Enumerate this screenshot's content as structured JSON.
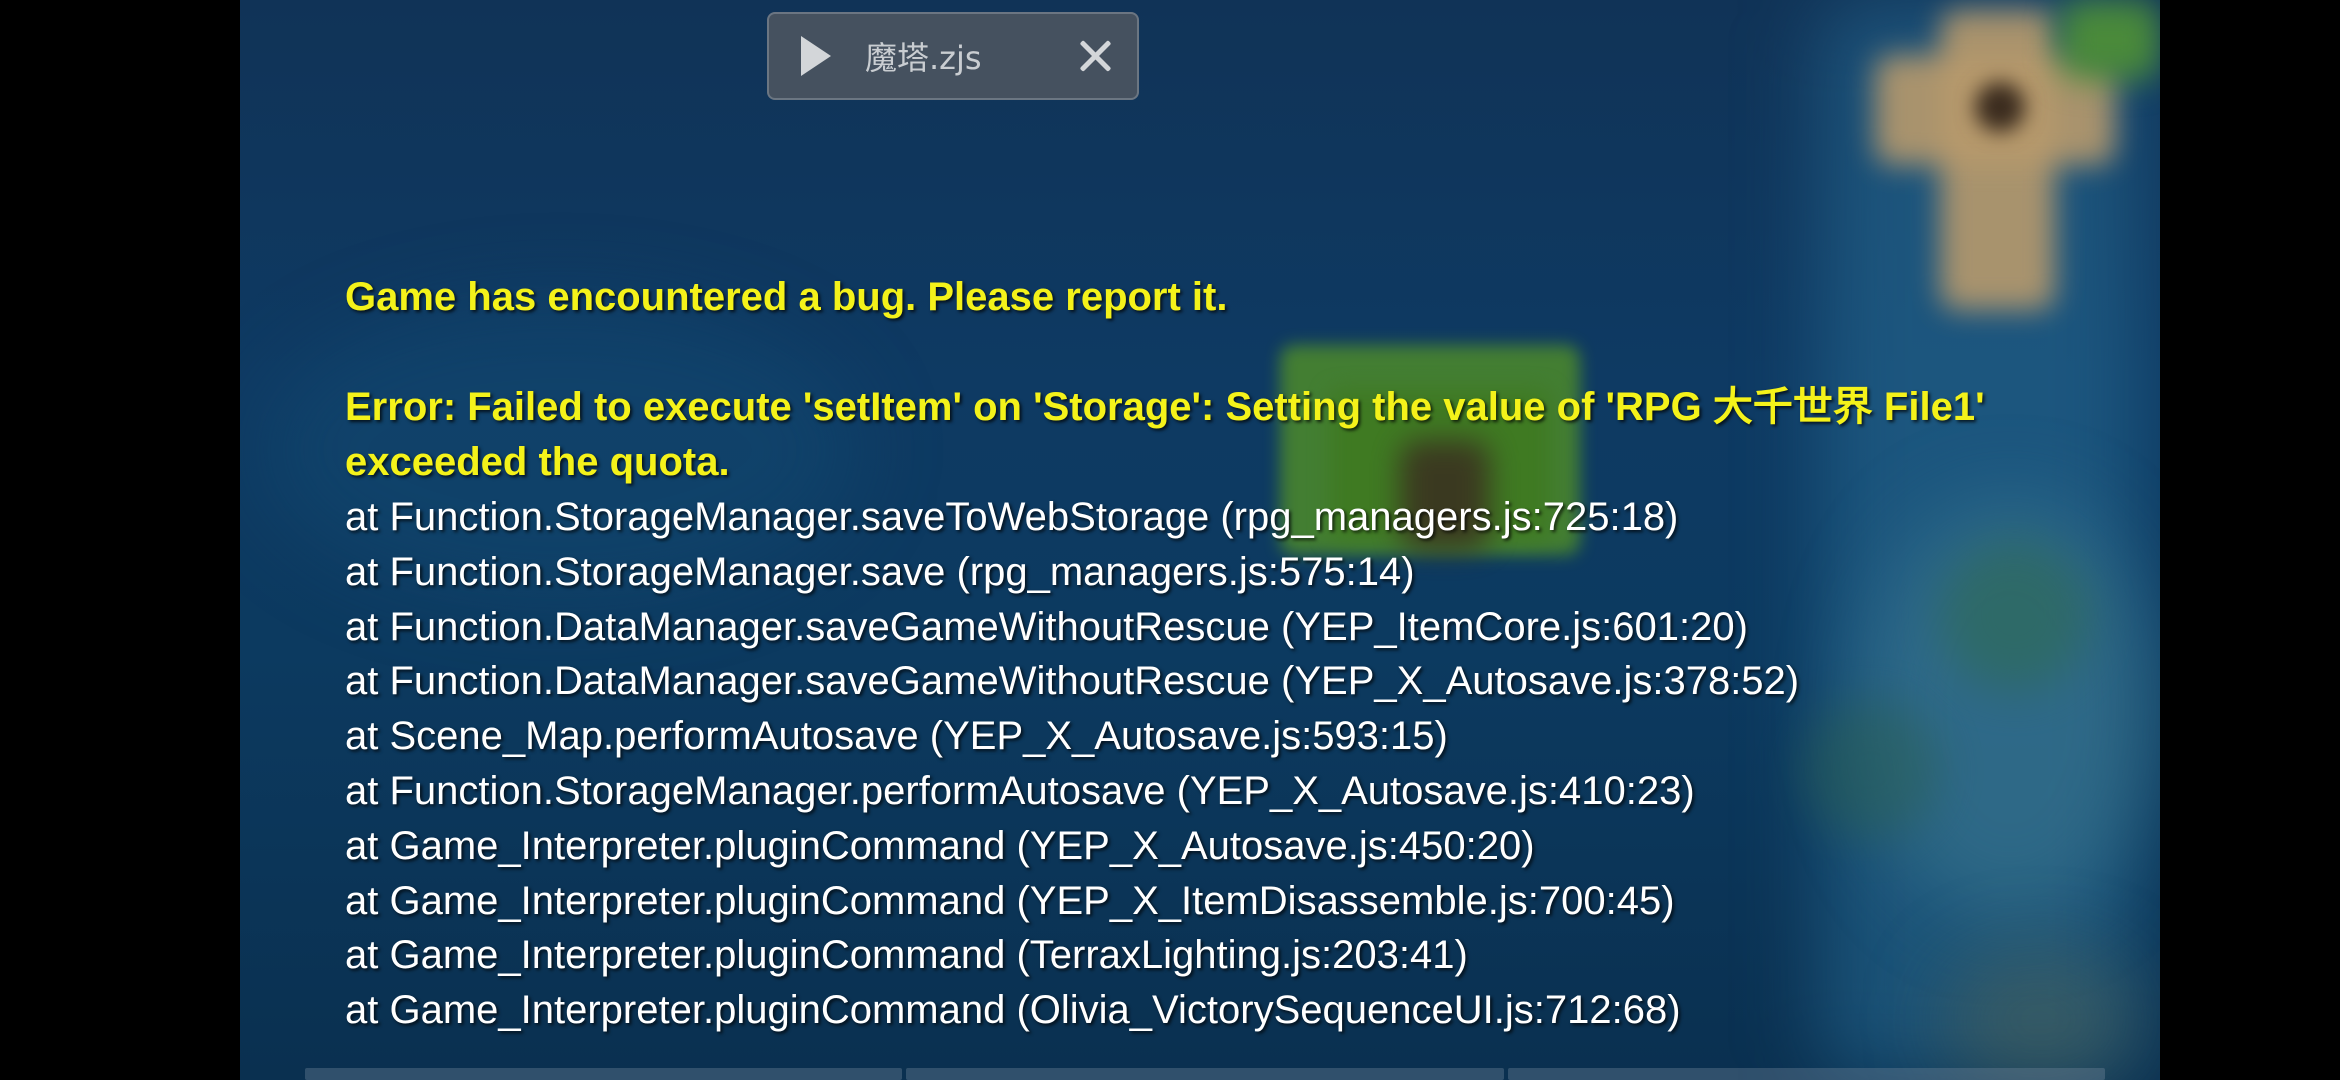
{
  "window": {
    "tab_title": "魔塔.zjs",
    "icons": {
      "play": "play-icon",
      "close": "close-icon"
    }
  },
  "error": {
    "title": "Game has encountered a bug. Please report it.",
    "message": "Error: Failed to execute 'setItem' on 'Storage': Setting the value of 'RPG 大千世界 File1' exceeded the quota.",
    "stack": [
      "at Function.StorageManager.saveToWebStorage (rpg_managers.js:725:18)",
      "at Function.StorageManager.save (rpg_managers.js:575:14)",
      "at Function.DataManager.saveGameWithoutRescue (YEP_ItemCore.js:601:20)",
      "at Function.DataManager.saveGameWithoutRescue (YEP_X_Autosave.js:378:52)",
      "at Scene_Map.performAutosave (YEP_X_Autosave.js:593:15)",
      "at Function.StorageManager.performAutosave (YEP_X_Autosave.js:410:23)",
      "at Game_Interpreter.pluginCommand (YEP_X_Autosave.js:450:20)",
      "at Game_Interpreter.pluginCommand (YEP_X_ItemDisassemble.js:700:45)",
      "at Game_Interpreter.pluginCommand (TerraxLighting.js:203:41)",
      "at Game_Interpreter.pluginCommand (Olivia_VictorySequenceUI.js:712:68)"
    ]
  },
  "colors": {
    "error_text": "#f4f21a",
    "stack_text": "#ffffff",
    "background": "#0e3a63"
  }
}
